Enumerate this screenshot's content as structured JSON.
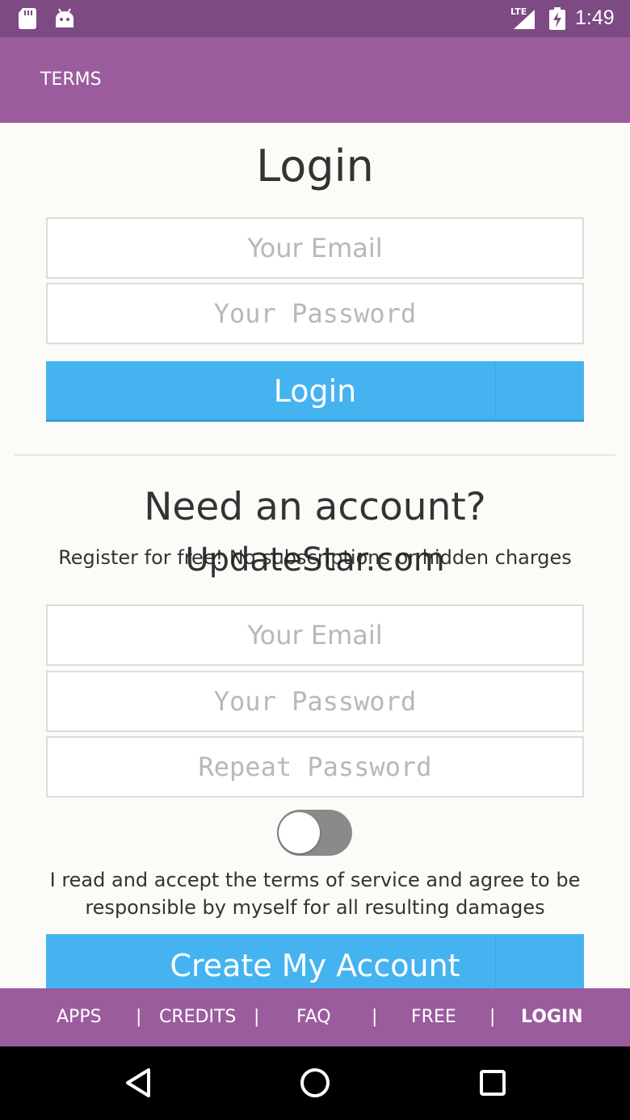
{
  "status_bar": {
    "network": "LTE",
    "time": "1:49"
  },
  "app_bar": {
    "title": "TERMS"
  },
  "login": {
    "title": "Login",
    "email_placeholder": "Your Email",
    "password_placeholder": "Your Password",
    "button_label": "Login"
  },
  "register": {
    "title": "Need an account?",
    "subtitle": "Register for free! No subscriptions or hidden charges",
    "email_placeholder": "Your Email",
    "password_placeholder": "Your Password",
    "repeat_password_placeholder": "Repeat Password",
    "terms_toggle_on": false,
    "terms_text": "I read and accept the terms of service and agree to be responsible by myself for all resulting damages",
    "button_label": "Create My Account"
  },
  "watermark": "UpdateStar.com",
  "bottom_nav": {
    "items": [
      "APPS",
      "CREDITS",
      "FAQ",
      "FREE",
      "LOGIN"
    ],
    "separator": "|",
    "active": "LOGIN"
  },
  "icons": {
    "status": [
      "sd-card-icon",
      "android-icon",
      "signal-icon",
      "battery-charging-icon"
    ],
    "system_nav": [
      "back-icon",
      "home-icon",
      "recents-icon"
    ]
  },
  "colors": {
    "status_bar": "#7d4a84",
    "app_bar": "#9b5c9e",
    "accent_button": "#45b3f0",
    "background": "#fcfbf8"
  }
}
